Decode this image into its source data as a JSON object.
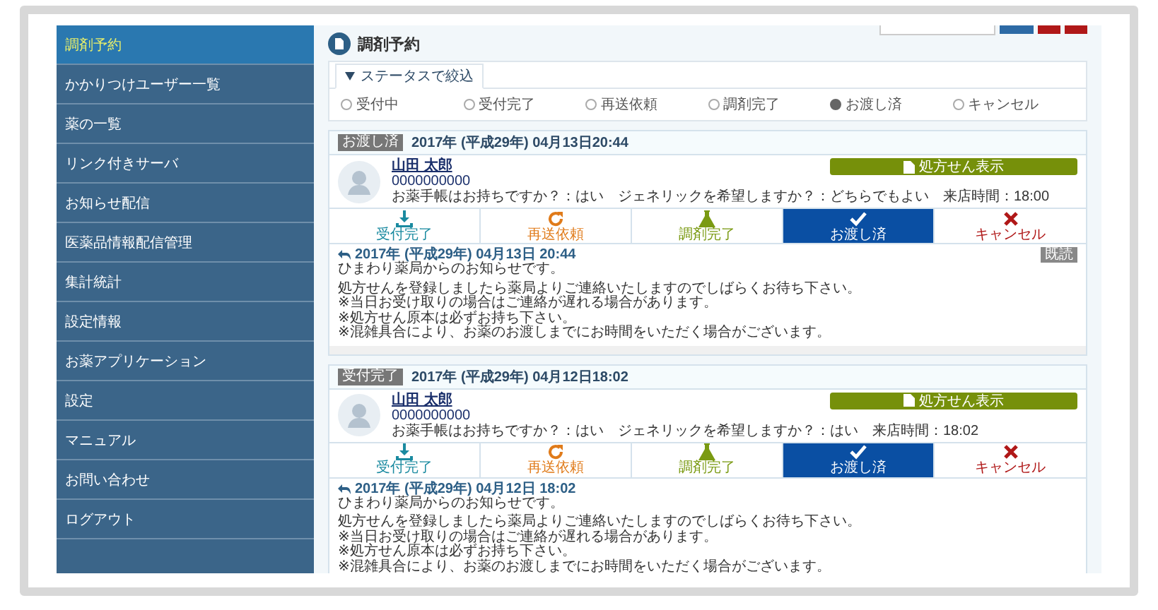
{
  "sidebar": {
    "items": [
      {
        "label": "調剤予約",
        "selected": true
      },
      {
        "label": "かかりつけユーザー一覧",
        "selected": false
      },
      {
        "label": "薬の一覧",
        "selected": false
      },
      {
        "label": "リンク付きサーバ",
        "selected": false
      },
      {
        "label": "お知らせ配信",
        "selected": false
      },
      {
        "label": "医薬品情報配信管理",
        "selected": false
      },
      {
        "label": "集計統計",
        "selected": false
      },
      {
        "label": "設定情報",
        "selected": false
      },
      {
        "label": "お薬アプリケーション",
        "selected": false
      },
      {
        "label": "設定",
        "selected": false
      },
      {
        "label": "マニュアル",
        "selected": false
      },
      {
        "label": "お問い合わせ",
        "selected": false
      },
      {
        "label": "ログアウト",
        "selected": false
      }
    ]
  },
  "header": {
    "title": "調剤予約"
  },
  "filter": {
    "tab": "ステータスで絞込",
    "options": [
      {
        "label": "受付中",
        "selected": false
      },
      {
        "label": "受付完了",
        "selected": false
      },
      {
        "label": "再送依頼",
        "selected": false
      },
      {
        "label": "調剤完了",
        "selected": false
      },
      {
        "label": "お渡し済",
        "selected": true
      },
      {
        "label": "キャンセル",
        "selected": false
      }
    ]
  },
  "reservations": [
    {
      "status": "お渡し済",
      "date": "2017年 (平成29年) 04月13日20:44",
      "patient": {
        "name": "山田 太郎",
        "id": "0000000000",
        "info": "お薬手帳はお持ちですか？：はい　ジェネリックを希望しますか？：どちらでもよい　来店時間：18:00"
      },
      "document_button": "処方せん表示",
      "actions": [
        {
          "kind": "accept",
          "label": "受付完了",
          "selected": false
        },
        {
          "kind": "resend",
          "label": "再送依頼",
          "selected": false
        },
        {
          "kind": "dispensed",
          "label": "調剤完了",
          "selected": false
        },
        {
          "kind": "handed",
          "label": "お渡し済",
          "selected": true
        },
        {
          "kind": "cancel",
          "label": "キャンセル",
          "selected": false
        }
      ],
      "message": {
        "date": "2017年 (平成29年) 04月13日 20:44",
        "read_badge": "既読",
        "greeting": "ひまわり薬局からのお知らせです。",
        "lines": [
          "処方せんを登録しましたら薬局よりご連絡いたしますのでしばらくお待ち下さい。",
          "※当日お受け取りの場合はご連絡が遅れる場合があります。",
          "※処方せん原本は必ずお持ち下さい。",
          "※混雑具合により、お薬のお渡しまでにお時間をいただく場合がございます。"
        ]
      }
    },
    {
      "status": "受付完了",
      "date": "2017年 (平成29年) 04月12日18:02",
      "patient": {
        "name": "山田 太郎",
        "id": "0000000000",
        "info": "お薬手帳はお持ちですか？：はい　ジェネリックを希望しますか？：はい　来店時間：18:02"
      },
      "document_button": "処方せん表示",
      "actions": [
        {
          "kind": "accept",
          "label": "受付完了",
          "selected": false
        },
        {
          "kind": "resend",
          "label": "再送依頼",
          "selected": false
        },
        {
          "kind": "dispensed",
          "label": "調剤完了",
          "selected": false
        },
        {
          "kind": "handed",
          "label": "お渡し済",
          "selected": true
        },
        {
          "kind": "cancel",
          "label": "キャンセル",
          "selected": false
        }
      ],
      "message": {
        "date": "2017年 (平成29年) 04月12日 18:02",
        "greeting": "ひまわり薬局からのお知らせです。",
        "lines": [
          "処方せんを登録しましたら薬局よりご連絡いたしますのでしばらくお待ち下さい。",
          "※当日お受け取りの場合はご連絡が遅れる場合があります。",
          "※処方せん原本は必ずお持ち下さい。",
          "※混雑具合により、お薬のお渡しまでにお時間をいただく場合がございます。"
        ]
      }
    }
  ]
}
